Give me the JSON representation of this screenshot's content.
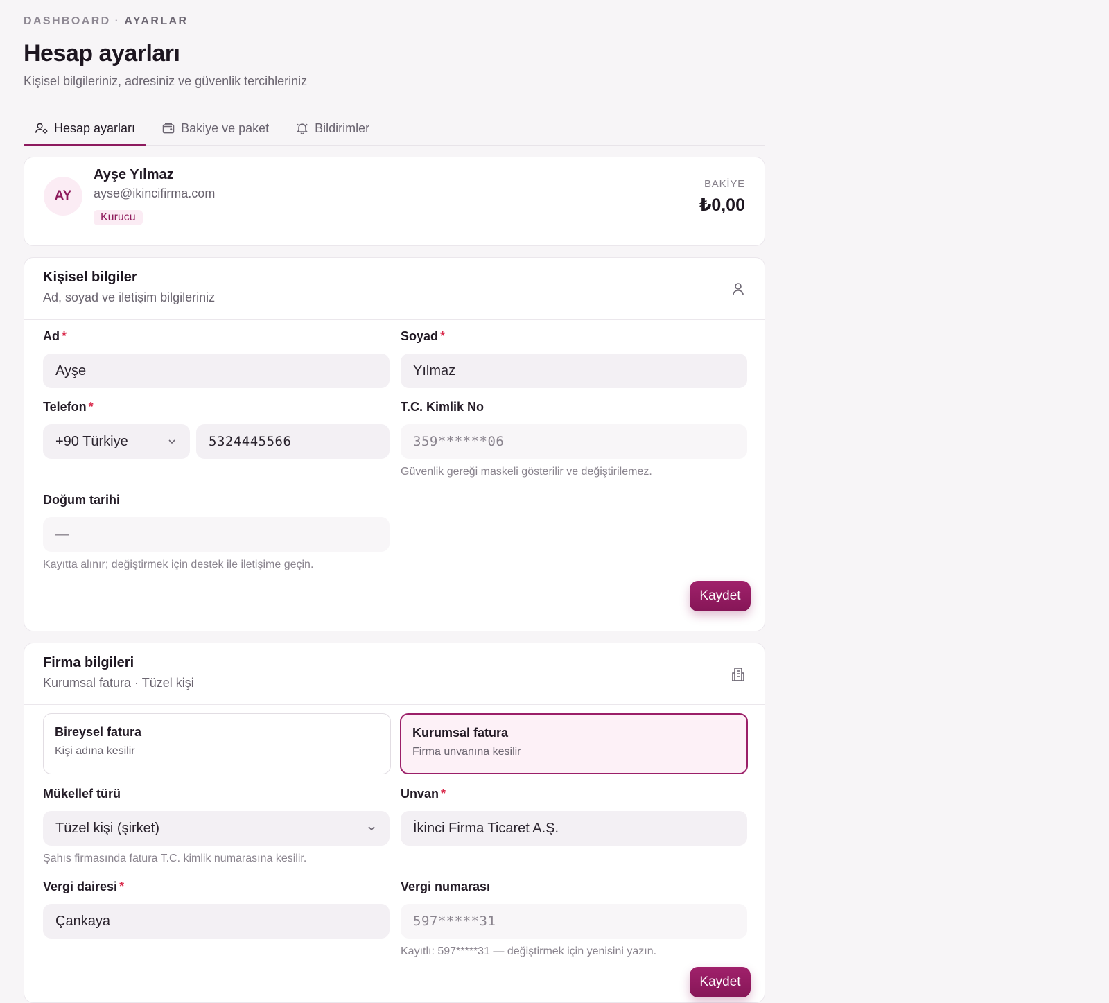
{
  "breadcrumb": {
    "root": "DASHBOARD",
    "separator": "·",
    "current": "AYARLAR"
  },
  "page": {
    "title": "Hesap ayarları",
    "subtitle": "Kişisel bilgileriniz, adresiniz ve güvenlik tercihleriniz"
  },
  "tabs": [
    {
      "label": "Hesap ayarları",
      "icon": "user-settings-icon",
      "active": true
    },
    {
      "label": "Bakiye ve paket",
      "icon": "wallet-icon",
      "active": false
    },
    {
      "label": "Bildirimler",
      "icon": "bell-icon",
      "active": false
    }
  ],
  "profile": {
    "initials": "AY",
    "name": "Ayşe Yılmaz",
    "email": "ayse@ikincifirma.com",
    "role": "Kurucu",
    "balance_label": "BAKİYE",
    "balance_value": "₺0,00"
  },
  "personal": {
    "title": "Kişisel bilgiler",
    "subtitle": "Ad, soyad ve iletişim bilgileriniz",
    "icon": "user-icon",
    "first_name": {
      "label": "Ad",
      "required_mark": "*",
      "value": "Ayşe"
    },
    "last_name": {
      "label": "Soyad",
      "required_mark": "*",
      "value": "Yılmaz"
    },
    "phone": {
      "label": "Telefon",
      "required_mark": "*",
      "country": "+90 Türkiye",
      "number": "5324445566"
    },
    "tc": {
      "label": "T.C. Kimlik No",
      "value": "359******06",
      "hint": "Güvenlik gereği maskeli gösterilir ve değiştirilemez."
    },
    "birth": {
      "label": "Doğum tarihi",
      "value": "—",
      "hint": "Kayıtta alınır; değiştirmek için destek ile iletişime geçin."
    },
    "save_label": "Kaydet"
  },
  "company": {
    "title": "Firma bilgileri",
    "subtitle": "Kurumsal fatura · Tüzel kişi",
    "icon": "building-icon",
    "options": [
      {
        "title": "Bireysel fatura",
        "subtitle": "Kişi adına kesilir",
        "selected": false
      },
      {
        "title": "Kurumsal fatura",
        "subtitle": "Firma unvanına kesilir",
        "selected": true
      }
    ],
    "taxpayer_type": {
      "label": "Mükellef türü",
      "value": "Tüzel kişi (şirket)",
      "hint": "Şahıs firmasında fatura T.C. kimlik numarasına kesilir."
    },
    "title_field": {
      "label": "Unvan",
      "required_mark": "*",
      "value": "İkinci Firma Ticaret A.Ş."
    },
    "tax_office": {
      "label": "Vergi dairesi",
      "required_mark": "*",
      "value": "Çankaya"
    },
    "tax_number": {
      "label": "Vergi numarası",
      "placeholder": "597*****31",
      "hint": "Kayıtlı: 597*****31 — değiştirmek için yenisini yazın."
    },
    "save_label": "Kaydet"
  },
  "colors": {
    "accent": "#8d1a5e",
    "required": "#d92a4b",
    "background": "#f7f5f7"
  }
}
